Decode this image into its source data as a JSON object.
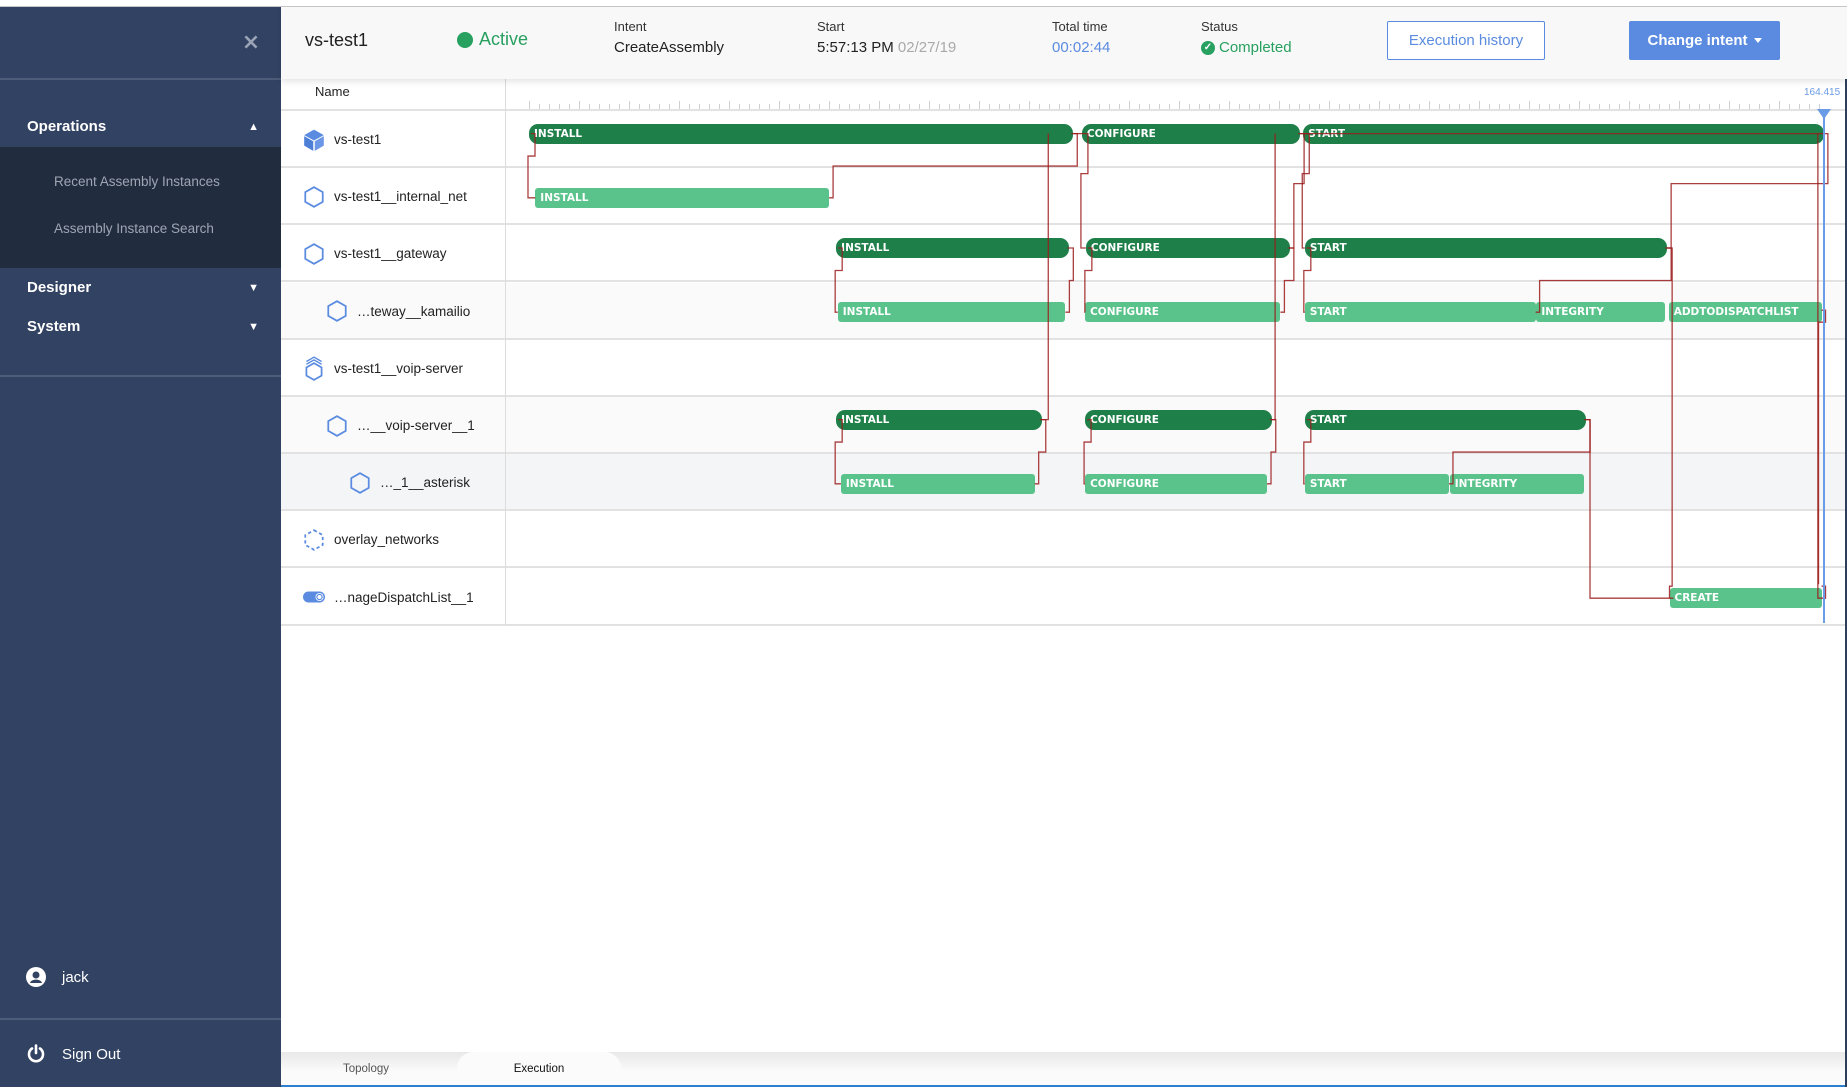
{
  "sidebar": {
    "close_icon": "close-icon",
    "sections": [
      {
        "label": "Operations",
        "expanded": true,
        "items": [
          "Recent Assembly Instances",
          "Assembly Instance Search"
        ]
      },
      {
        "label": "Designer",
        "expanded": false
      },
      {
        "label": "System",
        "expanded": false
      }
    ],
    "user": {
      "name": "jack",
      "icon": "user-circle-icon"
    },
    "sign_out": {
      "label": "Sign Out",
      "icon": "power-icon"
    }
  },
  "header": {
    "title": "vs-test1",
    "state": "Active",
    "intent": {
      "label": "Intent",
      "value": "CreateAssembly"
    },
    "start": {
      "label": "Start",
      "time": "5:57:13 PM",
      "date": "02/27/19"
    },
    "total_time": {
      "label": "Total time",
      "value": "00:02:44"
    },
    "status": {
      "label": "Status",
      "value": "Completed"
    },
    "execution_history_label": "Execution history",
    "change_intent_label": "Change intent"
  },
  "grid": {
    "name_header": "Name",
    "timeline_end_label": "164.415",
    "timeline_max": 164.415
  },
  "rows": [
    {
      "name": "vs-test1",
      "icon": "assembly-cube-icon",
      "indent": 0
    },
    {
      "name": "vs-test1__internal_net",
      "icon": "hexagon-icon",
      "indent": 0
    },
    {
      "name": "vs-test1__gateway",
      "icon": "hexagon-icon",
      "indent": 0
    },
    {
      "name": "…teway__kamailio",
      "icon": "hexagon-icon",
      "indent": 1
    },
    {
      "name": "vs-test1__voip-server",
      "icon": "stacked-hexagon-icon",
      "indent": 0
    },
    {
      "name": "…__voip-server__1",
      "icon": "hexagon-icon",
      "indent": 1
    },
    {
      "name": "…_1__asterisk",
      "icon": "hexagon-icon",
      "indent": 2
    },
    {
      "name": "overlay_networks",
      "icon": "dashed-hexagon-icon",
      "indent": 0
    },
    {
      "name": "…nageDispatchList__1",
      "icon": "toggle-icon",
      "indent": 0
    }
  ],
  "bars": [
    {
      "row": 0,
      "label": "INSTALL",
      "kind": "dark",
      "start": 0.0,
      "end": 69.1
    },
    {
      "row": 0,
      "label": "CONFIGURE",
      "kind": "dark",
      "start": 70.2,
      "end": 97.9
    },
    {
      "row": 0,
      "label": "START",
      "kind": "dark",
      "start": 98.3,
      "end": 164.4
    },
    {
      "row": 1,
      "label": "INSTALL",
      "kind": "light",
      "start": 0.8,
      "end": 38.1
    },
    {
      "row": 2,
      "label": "INSTALL",
      "kind": "dark",
      "start": 39.0,
      "end": 68.6
    },
    {
      "row": 2,
      "label": "CONFIGURE",
      "kind": "dark",
      "start": 70.7,
      "end": 96.6
    },
    {
      "row": 2,
      "label": "START",
      "kind": "dark",
      "start": 98.5,
      "end": 144.5
    },
    {
      "row": 3,
      "label": "INSTALL",
      "kind": "light",
      "start": 39.2,
      "end": 68.1
    },
    {
      "row": 3,
      "label": "CONFIGURE",
      "kind": "light",
      "start": 70.6,
      "end": 95.4
    },
    {
      "row": 3,
      "label": "START",
      "kind": "light",
      "start": 98.5,
      "end": 127.8
    },
    {
      "row": 3,
      "label": "INTEGRITY",
      "kind": "light",
      "start": 127.9,
      "end": 144.2
    },
    {
      "row": 3,
      "label": "ADDTODISPATCHLIST",
      "kind": "light",
      "start": 144.7,
      "end": 164.1
    },
    {
      "row": 5,
      "label": "INSTALL",
      "kind": "dark",
      "start": 39.0,
      "end": 65.1
    },
    {
      "row": 5,
      "label": "CONFIGURE",
      "kind": "dark",
      "start": 70.6,
      "end": 94.3
    },
    {
      "row": 5,
      "label": "START",
      "kind": "dark",
      "start": 98.5,
      "end": 134.2
    },
    {
      "row": 6,
      "label": "INSTALL",
      "kind": "light",
      "start": 39.6,
      "end": 64.2
    },
    {
      "row": 6,
      "label": "CONFIGURE",
      "kind": "light",
      "start": 70.6,
      "end": 93.7
    },
    {
      "row": 6,
      "label": "START",
      "kind": "light",
      "start": 98.5,
      "end": 116.8
    },
    {
      "row": 6,
      "label": "INTEGRITY",
      "kind": "light",
      "start": 116.9,
      "end": 133.9
    },
    {
      "row": 8,
      "label": "CREATE",
      "kind": "light",
      "start": 144.8,
      "end": 164.1
    }
  ],
  "bottom_tabs": [
    {
      "label": "Topology",
      "active": false
    },
    {
      "label": "Execution",
      "active": true
    }
  ],
  "colors": {
    "sidebar_bg": "#324262",
    "accent_blue": "#5a8be0",
    "active_green": "#27a060",
    "bar_dark": "#1e7f49",
    "bar_light": "#5ac38b",
    "dependency_line": "#9b1c1c"
  }
}
